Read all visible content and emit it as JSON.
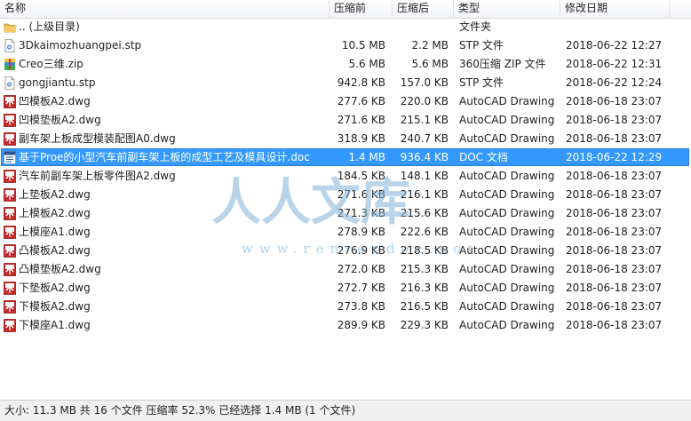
{
  "columns": {
    "name": "名称",
    "compressed": "压缩前",
    "original": "压缩后",
    "type": "类型",
    "modified": "修改日期"
  },
  "files": [
    {
      "name": ".. (上级目录)",
      "compressed": "",
      "original": "",
      "type": "文件夹",
      "modified": "",
      "icon": "folder-icon"
    },
    {
      "name": "3Dkaimozhuangpei.stp",
      "compressed": "10.5 MB",
      "original": "2.2 MB",
      "type": "STP 文件",
      "modified": "2018-06-22 12:27",
      "icon": "stp-file-icon"
    },
    {
      "name": "Creo三维.zip",
      "compressed": "5.6 MB",
      "original": "5.6 MB",
      "type": "360压缩 ZIP 文件",
      "modified": "2018-06-22 12:31",
      "icon": "zip-file-icon"
    },
    {
      "name": "gongjiantu.stp",
      "compressed": "942.8 KB",
      "original": "157.0 KB",
      "type": "STP 文件",
      "modified": "2018-06-22 12:24",
      "icon": "stp-file-icon"
    },
    {
      "name": "凹模板A2.dwg",
      "compressed": "277.6 KB",
      "original": "220.0 KB",
      "type": "AutoCAD Drawing",
      "modified": "2018-06-18 23:07",
      "icon": "dwg-file-icon"
    },
    {
      "name": "凹模垫板A2.dwg",
      "compressed": "271.6 KB",
      "original": "215.1 KB",
      "type": "AutoCAD Drawing",
      "modified": "2018-06-18 23:07",
      "icon": "dwg-file-icon"
    },
    {
      "name": "副车架上板成型模装配图A0.dwg",
      "compressed": "318.9 KB",
      "original": "240.7 KB",
      "type": "AutoCAD Drawing",
      "modified": "2018-06-18 23:07",
      "icon": "dwg-file-icon"
    },
    {
      "name": "基于Proe的小型汽车前副车架上板的成型工艺及模具设计.doc",
      "compressed": "1.4 MB",
      "original": "936.4 KB",
      "type": "DOC 文档",
      "modified": "2018-06-22 12:29",
      "icon": "doc-file-icon",
      "selected": true
    },
    {
      "name": "汽车前副车架上板零件图A2.dwg",
      "compressed": "184.5 KB",
      "original": "148.1 KB",
      "type": "AutoCAD Drawing",
      "modified": "2018-06-18 23:07",
      "icon": "dwg-file-icon"
    },
    {
      "name": "上垫板A2.dwg",
      "compressed": "271.6 KB",
      "original": "216.1 KB",
      "type": "AutoCAD Drawing",
      "modified": "2018-06-18 23:07",
      "icon": "dwg-file-icon"
    },
    {
      "name": "上模板A2.dwg",
      "compressed": "271.3 KB",
      "original": "215.6 KB",
      "type": "AutoCAD Drawing",
      "modified": "2018-06-18 23:07",
      "icon": "dwg-file-icon"
    },
    {
      "name": "上模座A1.dwg",
      "compressed": "278.9 KB",
      "original": "222.6 KB",
      "type": "AutoCAD Drawing",
      "modified": "2018-06-18 23:07",
      "icon": "dwg-file-icon"
    },
    {
      "name": "凸模板A2.dwg",
      "compressed": "276.9 KB",
      "original": "218.5 KB",
      "type": "AutoCAD Drawing",
      "modified": "2018-06-18 23:07",
      "icon": "dwg-file-icon"
    },
    {
      "name": "凸模垫板A2.dwg",
      "compressed": "272.0 KB",
      "original": "215.3 KB",
      "type": "AutoCAD Drawing",
      "modified": "2018-06-18 23:07",
      "icon": "dwg-file-icon"
    },
    {
      "name": "下垫板A2.dwg",
      "compressed": "272.7 KB",
      "original": "216.3 KB",
      "type": "AutoCAD Drawing",
      "modified": "2018-06-18 23:07",
      "icon": "dwg-file-icon"
    },
    {
      "name": "下模板A2.dwg",
      "compressed": "273.8 KB",
      "original": "216.5 KB",
      "type": "AutoCAD Drawing",
      "modified": "2018-06-18 23:07",
      "icon": "dwg-file-icon"
    },
    {
      "name": "下模座A1.dwg",
      "compressed": "289.9 KB",
      "original": "229.3 KB",
      "type": "AutoCAD Drawing",
      "modified": "2018-06-18 23:07",
      "icon": "dwg-file-icon"
    }
  ],
  "watermark": {
    "text": "人人文库",
    "url": "www.renrendoc.com"
  },
  "status": "大小: 11.3 MB 共 16 个文件 压缩率 52.3% 已经选择 1.4 MB (1 个文件)",
  "colors": {
    "selection": "#3399ff",
    "dwg_icon": "#c62828",
    "watermark": "#7fb0d6"
  }
}
